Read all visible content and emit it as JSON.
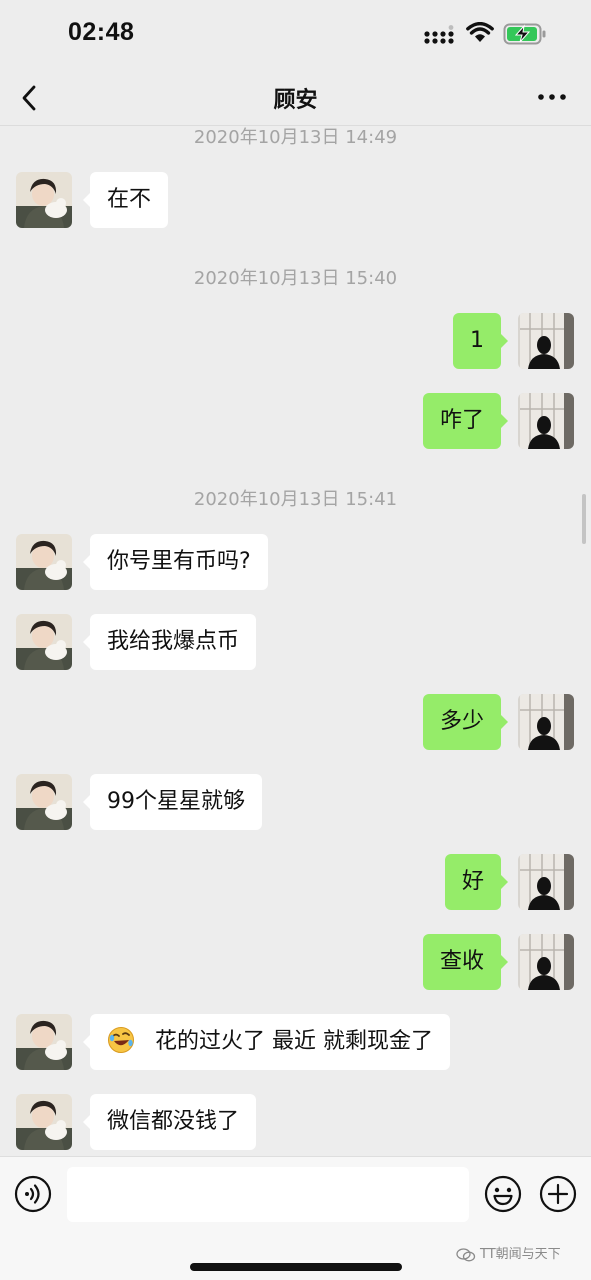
{
  "status_bar": {
    "time": "02:48"
  },
  "nav": {
    "title": "顾安"
  },
  "messages": [
    {
      "type": "timestamp",
      "text": "2020年10月13日 14:49"
    },
    {
      "type": "message",
      "side": "left",
      "text": "在不"
    },
    {
      "type": "timestamp",
      "text": "2020年10月13日 15:40"
    },
    {
      "type": "message",
      "side": "right",
      "text": "1"
    },
    {
      "type": "message",
      "side": "right",
      "text": "咋了"
    },
    {
      "type": "timestamp",
      "text": "2020年10月13日 15:41"
    },
    {
      "type": "message",
      "side": "left",
      "text": "你号里有币吗?"
    },
    {
      "type": "message",
      "side": "left",
      "text": "我给我爆点币"
    },
    {
      "type": "message",
      "side": "right",
      "text": "多少"
    },
    {
      "type": "message",
      "side": "left",
      "text": "99个星星就够"
    },
    {
      "type": "message",
      "side": "right",
      "text": "好"
    },
    {
      "type": "message",
      "side": "right",
      "text": "查收"
    },
    {
      "type": "message",
      "side": "left",
      "emoji": "rolling-on-floor-laughing-icon",
      "text": "花的过火了  最近 就剩现金了"
    },
    {
      "type": "message",
      "side": "left",
      "text": "微信都没钱了"
    }
  ],
  "input": {
    "value": ""
  },
  "watermark": {
    "text": "TT朝闻与天下"
  },
  "colors": {
    "background": "#ededed",
    "self_bubble": "#95ec69",
    "other_bubble": "#ffffff",
    "timestamp": "#a4a4a4"
  }
}
